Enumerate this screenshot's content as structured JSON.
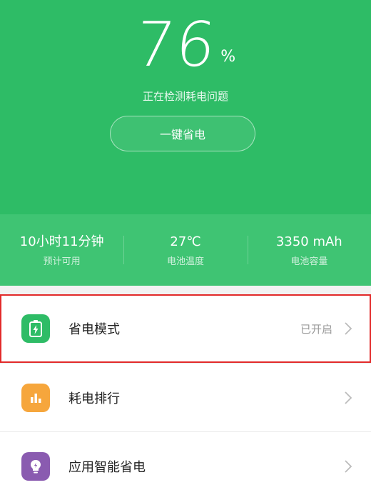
{
  "battery": {
    "level": "76",
    "unit": "%",
    "status_text": "正在检测耗电问题",
    "optimize_label": "一键省电"
  },
  "stats": [
    {
      "value": "10小时11分钟",
      "label": "预计可用"
    },
    {
      "value": "27℃",
      "label": "电池温度"
    },
    {
      "value": "3350 mAh",
      "label": "电池容量"
    }
  ],
  "menu": [
    {
      "label": "省电模式",
      "status": "已开启",
      "icon": "battery-charging-icon",
      "icon_color": "#2ebc66"
    },
    {
      "label": "耗电排行",
      "status": "",
      "icon": "bar-chart-icon",
      "icon_color": "#f6a63c"
    },
    {
      "label": "应用智能省电",
      "status": "",
      "icon": "lightbulb-icon",
      "icon_color": "#8a5bb0"
    }
  ],
  "colors": {
    "primary": "#2ebc66",
    "stats_bg": "#3fc473",
    "highlight": "#e22a2a"
  }
}
